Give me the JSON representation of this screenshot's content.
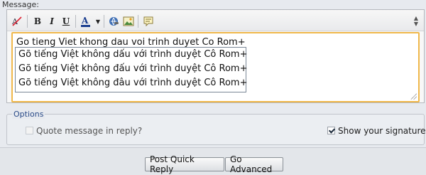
{
  "message_label": "Message:",
  "toolbar": {
    "buttons": [
      {
        "name": "remove-format",
        "glyph": "✗"
      },
      {
        "name": "bold",
        "glyph": "B"
      },
      {
        "name": "italic",
        "glyph": "I"
      },
      {
        "name": "underline",
        "glyph": "U"
      },
      {
        "name": "font-color",
        "glyph": "A"
      },
      {
        "name": "insert-link",
        "glyph": "🔗"
      },
      {
        "name": "insert-image",
        "glyph": "▣"
      },
      {
        "name": "quote",
        "glyph": "☰"
      }
    ],
    "font_color_value": "#1a3d8f"
  },
  "editor": {
    "typed_words": [
      "Go",
      "tieng",
      "Viet",
      "khong",
      "dau",
      "voi",
      "trinh",
      "duyet",
      "Co",
      "Rom+"
    ],
    "suggestions": [
      "Gõ tiếng Việt không dấu với trình duyệt Cô Rom+",
      "Gõ tiếng Việt không đấu với trình duyệt Cô Rom+",
      "Gõ tiếng Việt không đâu với trình duyệt Cô Rom+"
    ]
  },
  "options": {
    "legend": "Options",
    "quote_label": "Quote message in reply?",
    "quote_checked": false,
    "signature_label": "Show your signature",
    "signature_checked": true
  },
  "buttons": {
    "post": "Post Quick Reply",
    "advanced": "Go Advanced"
  },
  "colors": {
    "accent_border": "#f0b84b",
    "legend_text": "#2a4b88"
  }
}
